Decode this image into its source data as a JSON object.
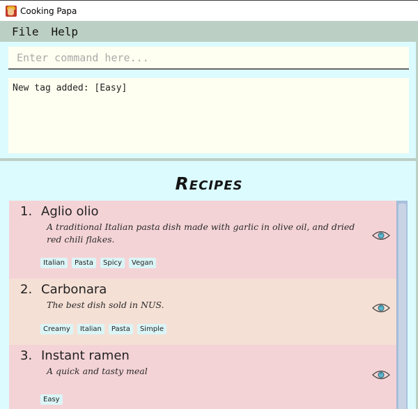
{
  "window": {
    "title": "Cooking Papa",
    "icon": "chef-avatar-icon"
  },
  "menu": {
    "items": [
      {
        "label": "File"
      },
      {
        "label": "Help"
      }
    ]
  },
  "command": {
    "placeholder": "Enter command here...",
    "value": ""
  },
  "result": {
    "text": "New tag added: [Easy]"
  },
  "recipes": {
    "title": "Recipes",
    "items": [
      {
        "index": "1.",
        "name": "Aglio olio",
        "description": "A traditional Italian pasta dish made with garlic in olive oil, and dried red chili flakes.",
        "tags": [
          "Italian",
          "Pasta",
          "Spicy",
          "Vegan"
        ],
        "view_icon": "eye-icon"
      },
      {
        "index": "2.",
        "name": "Carbonara",
        "description": "The best dish sold in NUS.",
        "tags": [
          "Creamy",
          "Italian",
          "Pasta",
          "Simple"
        ],
        "view_icon": "eye-icon"
      },
      {
        "index": "3.",
        "name": "Instant ramen",
        "description": "A quick and tasty meal",
        "tags": [
          "Easy"
        ],
        "view_icon": "eye-icon"
      }
    ]
  },
  "colors": {
    "menubar": "#bccfc4",
    "pane_background": "#dbfbff",
    "input_background": "#fefff0",
    "card_odd": "#f4d3d6",
    "card_even": "#f5e0d5",
    "tag_background": "#dbf5f7",
    "eye_pupil": "#5bb8d0"
  }
}
